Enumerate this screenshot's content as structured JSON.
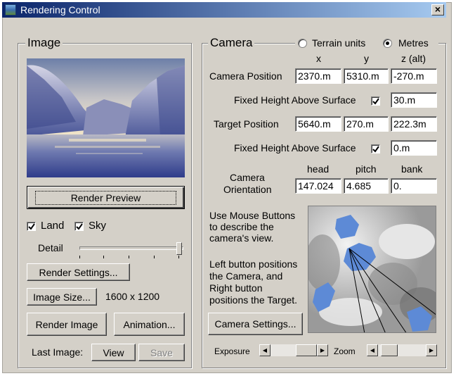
{
  "window": {
    "title": "Rendering Control",
    "close_label": "×"
  },
  "image_group": {
    "legend": "Image",
    "render_preview_label": "Render Preview",
    "land_label": "Land",
    "land_checked": true,
    "sky_label": "Sky",
    "sky_checked": true,
    "detail_label": "Detail",
    "detail_level": 1.0,
    "render_settings_label": "Render Settings...",
    "image_size_label": "Image Size...",
    "image_size_value": "1600 x 1200",
    "render_image_label": "Render Image",
    "animation_label": "Animation...",
    "last_image_label": "Last Image:",
    "view_label": "View",
    "save_label": "Save"
  },
  "camera_group": {
    "legend": "Camera",
    "terrain_units_label": "Terrain units",
    "metres_label": "Metres",
    "selected_units": "Metres",
    "col_x": "x",
    "col_y": "y",
    "col_z": "z (alt)",
    "camera_position_label": "Camera Position",
    "camera_position": {
      "x": "2370.m",
      "y": "5310.m",
      "z": "-270.m"
    },
    "fixed_height_label": "Fixed Height Above Surface",
    "camera_fixed_height_checked": true,
    "camera_fixed_height": "30.m",
    "target_position_label": "Target Position",
    "target_position": {
      "x": "5640.m",
      "y": "270.m",
      "z": "222.3m"
    },
    "target_fixed_height_checked": true,
    "target_fixed_height": "0.m",
    "col_head": "head",
    "col_pitch": "pitch",
    "col_bank": "bank",
    "orientation_label_1": "Camera",
    "orientation_label_2": "Orientation",
    "orientation": {
      "head": "147.024",
      "pitch": "4.685",
      "bank": "0."
    },
    "help_text_1": [
      "Use Mouse Buttons",
      "to describe the",
      "camera's view."
    ],
    "help_text_2": [
      "Left button positions",
      "the Camera, and",
      "Right button",
      "positions the Target."
    ],
    "camera_settings_label": "Camera Settings...",
    "exposure_label": "Exposure",
    "zoom_label": "Zoom",
    "colors": {
      "water": "#5d8ad6",
      "terrain_light": "#f2f2f2",
      "terrain_dark": "#6e6e6e"
    }
  }
}
